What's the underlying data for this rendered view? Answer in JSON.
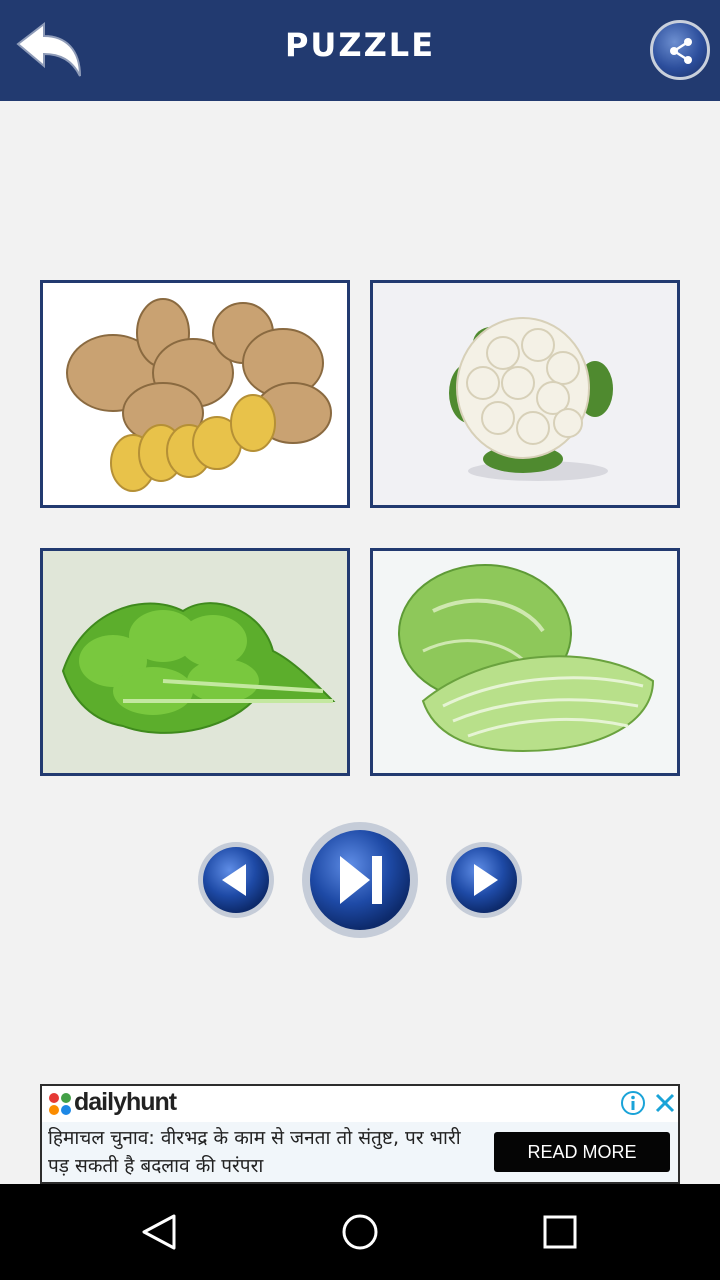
{
  "header": {
    "title": "PUZZLE",
    "back_icon": "back-arrow-icon",
    "share_icon": "share-icon"
  },
  "tiles": [
    {
      "subject": "ginger",
      "bg": "#ffffff"
    },
    {
      "subject": "cauliflower",
      "bg": "#f1f1f4"
    },
    {
      "subject": "mustard-greens",
      "bg": "#e0e6d8"
    },
    {
      "subject": "cabbage",
      "bg": "#f3f6f6"
    }
  ],
  "controls": {
    "prev_icon": "previous-icon",
    "skip_icon": "skip-next-icon",
    "next_icon": "play-next-icon"
  },
  "ad": {
    "brand": "dailyhunt",
    "headline": "हिमाचल चुनाव: वीरभद्र के काम से जनता तो संतुष्ट, पर भारी पड़ सकती है बदलाव की परंपरा",
    "cta": "READ MORE",
    "info_icon": "ad-info-icon",
    "close_icon": "ad-close-icon"
  },
  "system_nav": {
    "back_icon": "nav-back-icon",
    "home_icon": "nav-home-icon",
    "recents_icon": "nav-recents-icon"
  },
  "colors": {
    "header": "#223a70",
    "background": "#f2f2f2",
    "tile_border": "#223a70",
    "button_blue": "#1f4fa8"
  }
}
